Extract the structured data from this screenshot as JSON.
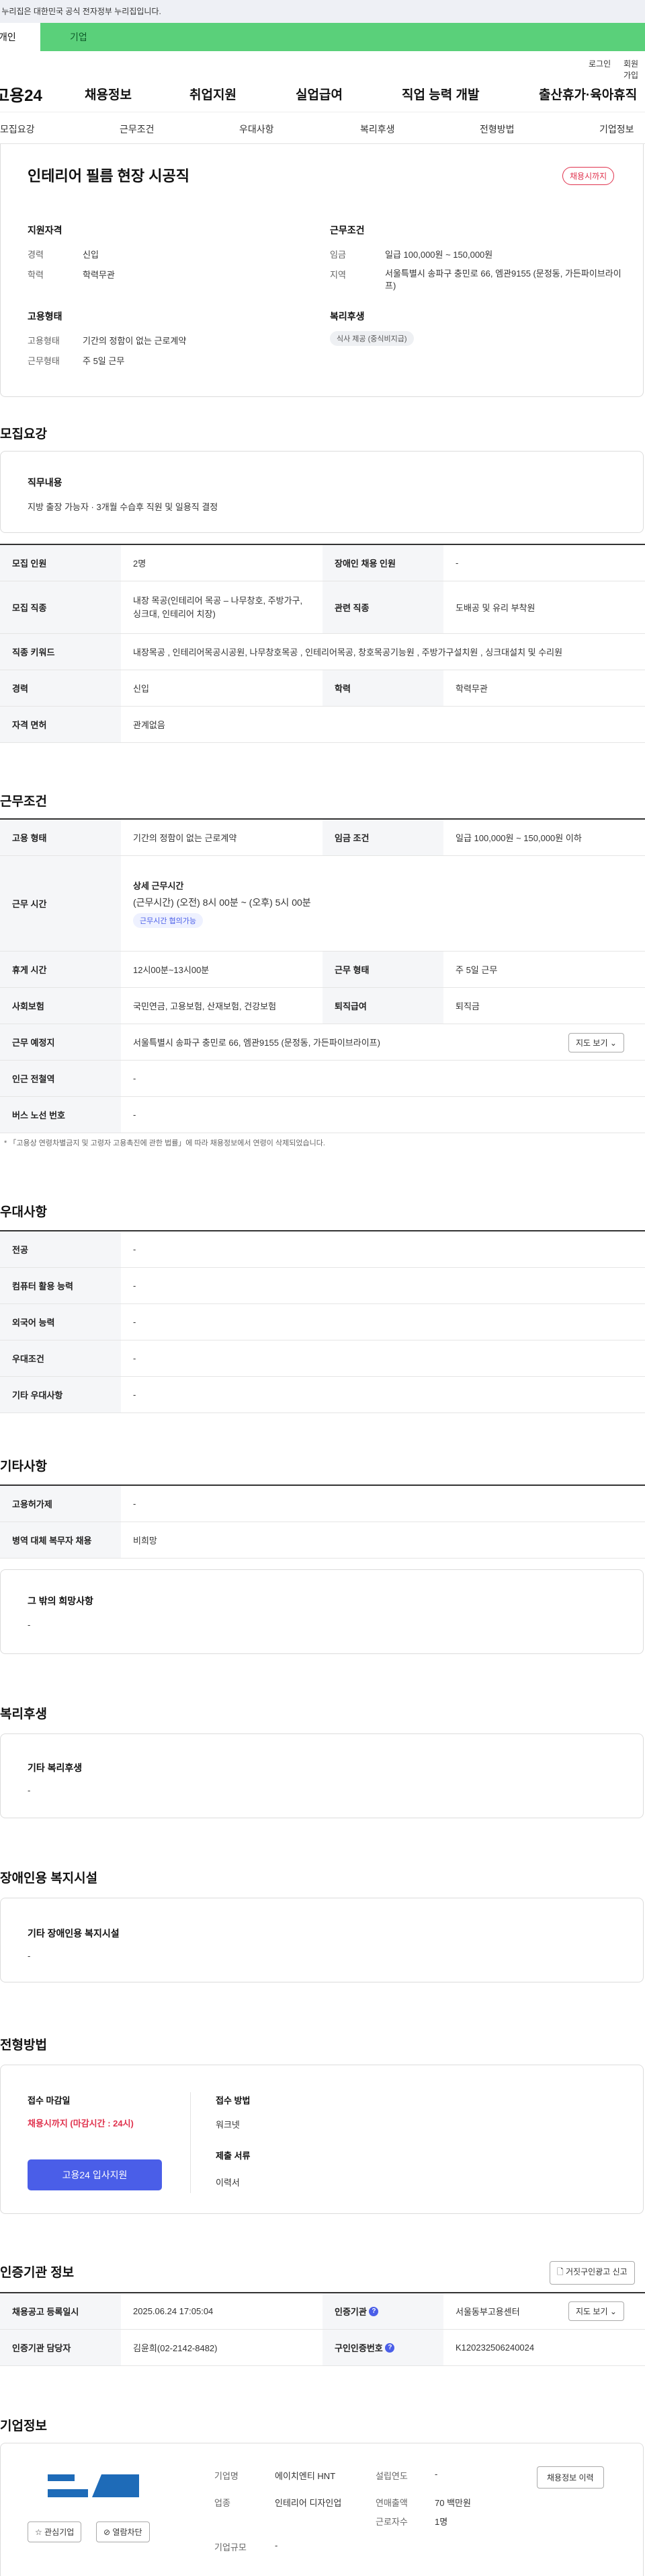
{
  "gov_banner": "이 누리집은 대한민국 공식 전자정부 누리집입니다.",
  "top_tabs": [
    "개인",
    "기업"
  ],
  "util": {
    "login": "로그인",
    "join": "회원가입"
  },
  "gnb": {
    "logo": "고용24",
    "items": [
      "채용정보",
      "취업지원",
      "실업급여",
      "직업 능력 개발",
      "출산휴가·육아휴직"
    ]
  },
  "subnav": [
    "모집요강",
    "근무조건",
    "우대사항",
    "복리후생",
    "전형방법",
    "기업정보"
  ],
  "job": {
    "title": "인테리어 필름 현장 시공직",
    "badge": "채용시까지"
  },
  "summary": {
    "qual_title": "지원자격",
    "career_label": "경력",
    "career": "신입",
    "edu_label": "학력",
    "edu": "학력무관",
    "cond_title": "근무조건",
    "wage_label": "임금",
    "wage": "일급 100,000원 ~ 150,000원",
    "area_label": "지역",
    "area": "서울특별시 송파구 충민로 66, 엠관9155 (문정동, 가든파이브라이프)",
    "emp_title": "고용형태",
    "emp_type_label": "고용형태",
    "emp_type": "기간의 정함이 없는 근로계약",
    "work_label": "근무형태",
    "work": "주 5일 근무",
    "welfare_title": "복리후생",
    "welfare_tag": "식사 제공 (중식비지급)"
  },
  "recruit": {
    "heading": "모집요강",
    "duty_title": "직무내용",
    "duty": "지방 출장 가능자 · 3개월 수습후 직원 및 일용직 결정",
    "rows": [
      {
        "th": "모집 인원",
        "td": "2명",
        "th2": "장애인 채용 인원",
        "td2": "-"
      },
      {
        "th": "모집 직종",
        "td": "내장 목공(인테리어 목공 – 나무창호, 주방가구, 싱크대, 인테리어 치장)",
        "th2": "관련 직종",
        "td2": "도배공 및 유리 부착원"
      },
      {
        "th": "직종 키워드",
        "td": "내장목공 , 인테리어목공시공원, 나무창호목공 , 인테리어목공, 창호목공기능원 , 주방가구설치원 , 싱크대설치 및 수리원"
      },
      {
        "th": "경력",
        "td": "신입",
        "th2": "학력",
        "td2": "학력무관"
      },
      {
        "th": "자격 면허",
        "td": "관계없음"
      }
    ]
  },
  "workcond": {
    "heading": "근무조건",
    "emp_th": "고용 형태",
    "emp_td": "기간의 정함이 없는 근로계약",
    "wage_th": "임금 조건",
    "wage_td": "일급 100,000원 ~ 150,000원 이하",
    "time_th": "근무 시간",
    "time_title": "상세 근무시간",
    "time_detail": "(근무시간) (오전) 8시 00분 ~ (오후) 5시 00분",
    "time_tag": "근무시간 협의가능",
    "rest_th": "휴게 시간",
    "rest_td": "12시00분~13시00분",
    "form_th": "근무 형태",
    "form_td": "주 5일 근무",
    "ins_th": "사회보험",
    "ins_td": "국민연금, 고용보험, 산재보험, 건강보험",
    "ret_th": "퇴직급여",
    "ret_td": "퇴직금",
    "place_th": "근무 예정지",
    "place_td": "서울특별시 송파구 충민로 66, 엠관9155 (문정동, 가든파이브라이프)",
    "map_btn": "지도 보기",
    "subway_th": "인근 전철역",
    "subway_td": "-",
    "bus_th": "버스 노선 번호",
    "bus_td": "-",
    "note": "* 「고용상 연령차별금지 및 고령자 고용촉진에 관한 법률」에 따라 채용정보에서 연령이 삭제되었습니다."
  },
  "pref": {
    "heading": "우대사항",
    "rows": [
      {
        "th": "전공",
        "td": "-"
      },
      {
        "th": "컴퓨터 활용 능력",
        "td": "-"
      },
      {
        "th": "외국어 능력",
        "td": "-"
      },
      {
        "th": "우대조건",
        "td": "-"
      },
      {
        "th": "기타 우대사항",
        "td": "-"
      }
    ]
  },
  "etc": {
    "heading": "기타사항",
    "rows": [
      {
        "th": "고용허가제",
        "td": "-"
      },
      {
        "th": "병역 대체 복무자 채용",
        "td": "비희망"
      }
    ],
    "other_title": "그 밖의 희망사항",
    "other": "-"
  },
  "benefit": {
    "heading": "복리후생",
    "title": "기타 복리후생",
    "value": "-"
  },
  "disab": {
    "heading": "장애인용 복지시설",
    "title": "기타 장애인용 복지시설",
    "value": "-"
  },
  "process": {
    "heading": "전형방법",
    "deadline_label": "접수 마감일",
    "deadline": "채용시까지 (마감시간 : 24시)",
    "apply_btn": "고용24 입사지원",
    "method_label": "접수 방법",
    "method": "워크넷",
    "docs_label": "제출 서류",
    "docs": "이력서"
  },
  "agency": {
    "heading": "인증기관 정보",
    "report_btn": "거짓구인광고 신고",
    "reg_th": "채용공고 등록일시",
    "reg_td": "2025.06.24 17:05:04",
    "org_th": "인증기관",
    "org_td": "서울동부고용센터",
    "map_btn": "지도 보기",
    "mgr_th": "인증기관 담당자",
    "mgr_td": "김윤희(02-2142-8482)",
    "no_th": "구인인증번호",
    "no_td": "K120232506240024"
  },
  "company": {
    "heading": "기업정보",
    "name_label": "기업명",
    "name": "에이치엔티 HNT",
    "ind_label": "업종",
    "ind": "인테리어 디자인업",
    "size_label": "기업규모",
    "size": "-",
    "est_label": "설립연도",
    "est": "-",
    "sales_label": "연매출액",
    "sales": "70 백만원",
    "emp_label": "근로자수",
    "emp": "1명",
    "fav_btn": "관심기업",
    "block_btn": "열람차단",
    "history_btn": "채용정보 이력"
  },
  "colors": {
    "green": "#5ad07a",
    "primary": "#4a5ee8",
    "red": "#e0334e"
  }
}
